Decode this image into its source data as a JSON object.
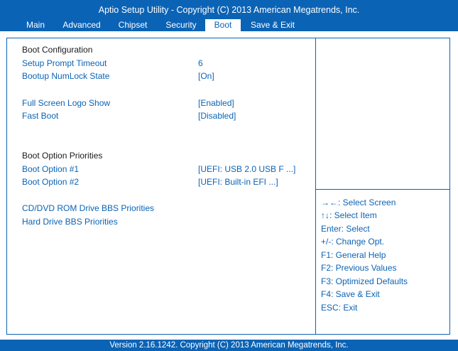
{
  "header": {
    "title": "Aptio Setup Utility - Copyright  (C)  2013 American Megatrends, Inc.",
    "tabs": [
      "Main",
      "Advanced",
      "Chipset",
      "Security",
      "Boot",
      "Save & Exit"
    ],
    "active_tab": "Boot"
  },
  "settings": {
    "boot_configuration_heading": "Boot Configuration",
    "setup_prompt_timeout": {
      "label": "Setup Prompt Timeout",
      "value": "6"
    },
    "bootup_numlock_state": {
      "label": "Bootup NumLock State",
      "value": "[On]"
    },
    "full_screen_logo_show": {
      "label": "Full Screen Logo Show",
      "value": "[Enabled]"
    },
    "fast_boot": {
      "label": "Fast Boot",
      "value": "[Disabled]"
    },
    "boot_option_priorities_heading": "Boot Option Priorities",
    "boot_option_1": {
      "label": "Boot Option #1",
      "value": "[UEFI: USB 2.0 USB F ...]"
    },
    "boot_option_2": {
      "label": "Boot Option #2",
      "value": "[UEFI: Built-in EFI ...]"
    },
    "cd_dvd_bbs": "CD/DVD ROM Drive BBS Priorities",
    "hdd_bbs": "Hard Drive BBS Priorities"
  },
  "help": [
    "→←: Select Screen",
    "↑↓: Select Item",
    "Enter: Select",
    "+/-: Change Opt.",
    "F1: General Help",
    "F2: Previous Values",
    "F3: Optimized Defaults",
    "F4: Save & Exit",
    "ESC: Exit"
  ],
  "footer": "Version 2.16.1242. Copyright  (C)  2013 American Megatrends, Inc.",
  "colors": {
    "accent": "#0b63b5",
    "background": "#ffffff",
    "heading_text": "#1a1a1a"
  }
}
